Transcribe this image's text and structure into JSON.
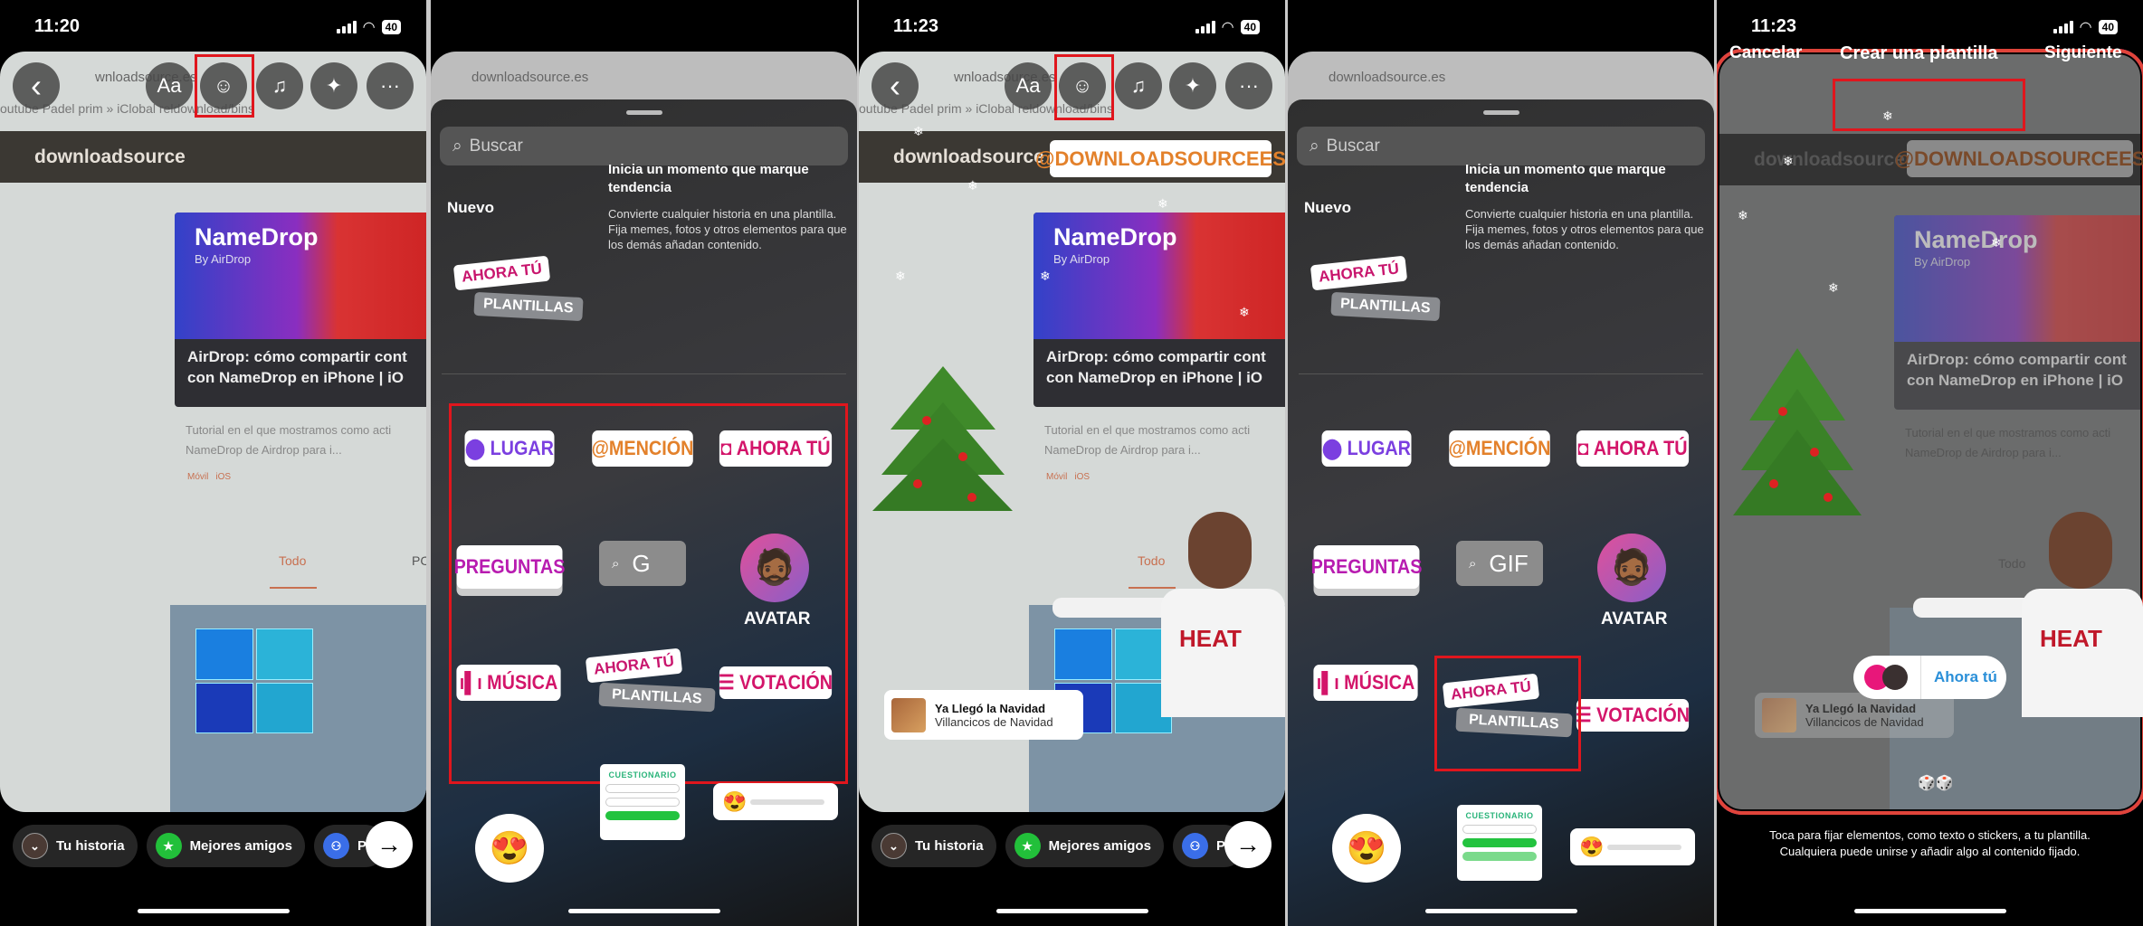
{
  "status_bars": [
    {
      "time": "11:20",
      "battery": "40"
    },
    {
      "time": "",
      "battery": ""
    },
    {
      "time": "11:23",
      "battery": "40"
    },
    {
      "time": "",
      "battery": ""
    },
    {
      "time": "11:23",
      "battery": "40"
    }
  ],
  "web": {
    "url": "downloadsource.es",
    "url_partial": "wnloadsource.es",
    "bookmarks": "outube   Padel   prim   »    iClobal     reldownload/bins",
    "logo": "downloadsource",
    "card_title": "NameDrop",
    "card_sub": "By AirDrop",
    "article_title": "AirDrop: cómo compartir cont con NameDrop en iPhone | iO",
    "desc_1": "Tutorial en el que mostramos como acti",
    "desc_2": "NameDrop de Airdrop para i...",
    "tags": [
      "Móvil",
      "iOS"
    ],
    "tab": "Todo",
    "tab_next": "PC"
  },
  "toolbar": {
    "text_label": "Aa",
    "icons": [
      "back-icon",
      "text-icon",
      "sticker-icon",
      "music-icon",
      "effects-icon",
      "more-icon"
    ],
    "more": "···",
    "back": "‹"
  },
  "share_bar": {
    "items": [
      {
        "label": "Tu historia",
        "color": "#e0502a"
      },
      {
        "label": "Mejores amigos",
        "color": "#22c03a"
      },
      {
        "label": "Pe",
        "color": "#3a6ee8"
      }
    ],
    "next": "→"
  },
  "sticker_tray": {
    "search_placeholder": "Buscar",
    "section": "Nuevo",
    "template_a": "AHORA TÚ",
    "template_b": "PLANTILLAS",
    "new_title": "Inicia un momento que marque tendencia",
    "new_desc": "Convierte cualquier historia en una plantilla. Fija memes, fotos y otros elementos para que los demás añadan contenido.",
    "stickers": {
      "lugar": "LUGAR",
      "mencion": "@MENCIÓN",
      "ahora_tu": "AHORA TÚ",
      "preguntas": "PREGUNTAS",
      "gif_partial": "G",
      "gif": "GIF",
      "avatar": "AVATAR",
      "musica": "MÚSICA",
      "votacion": "VOTACIÓN",
      "cuestionario": "CUESTIONARIO"
    },
    "emoji": "😍",
    "avatar_emoji": "🧔🏾"
  },
  "story": {
    "mention": "@DOWNLOADSOURCEES",
    "music_title": "Ya Llegó la Navidad",
    "music_artist": "Villancicos de Navidad",
    "jersey": "HEAT"
  },
  "template_editor": {
    "cancel": "Cancelar",
    "title": "Crear una plantilla",
    "next": "Siguiente",
    "ahora_tu": "Ahora tú",
    "hint_1": "Toca para fijar elementos, como texto o stickers, a tu plantilla.",
    "hint_2": "Cualquiera puede unirse y añadir algo al contenido fijado.",
    "dice": "🎲🎲"
  },
  "colors": {
    "highlight": "#e0161d",
    "mention": "#e3812b",
    "pink": "#c8156d",
    "lugar": "#7b3fe0"
  }
}
